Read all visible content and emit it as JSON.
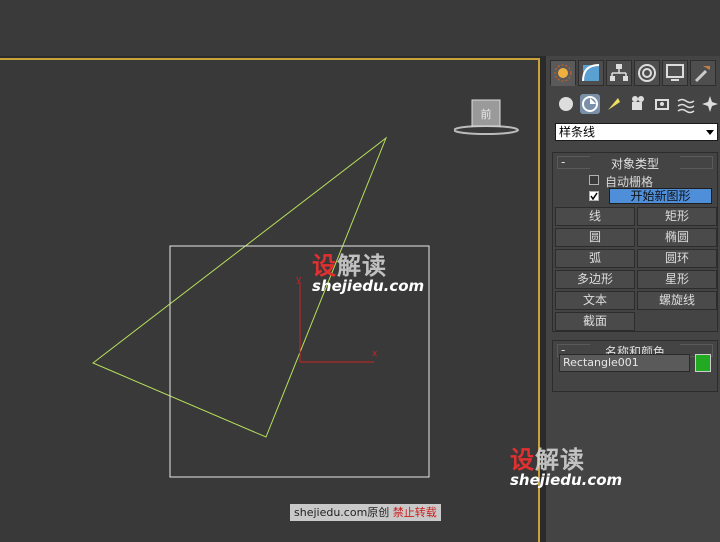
{
  "command_panel": {
    "tabs": [
      {
        "icon": "create-icon",
        "active": true
      },
      {
        "icon": "modify-icon",
        "active": false
      },
      {
        "icon": "hierarchy-icon",
        "active": false
      },
      {
        "icon": "motion-icon",
        "active": false
      },
      {
        "icon": "display-icon",
        "active": false
      },
      {
        "icon": "utilities-icon",
        "active": false
      }
    ],
    "subcategories": [
      {
        "icon": "geometry-icon",
        "active": false
      },
      {
        "icon": "shapes-icon",
        "active": true
      },
      {
        "icon": "lights-icon",
        "active": false
      },
      {
        "icon": "cameras-icon",
        "active": false
      },
      {
        "icon": "helpers-icon",
        "active": false
      },
      {
        "icon": "space-warps-icon",
        "active": false
      },
      {
        "icon": "systems-icon",
        "active": false
      }
    ],
    "category_dropdown": "样条线",
    "object_type": {
      "title": "对象类型",
      "auto_grid_label": "自动栅格",
      "auto_grid_checked": false,
      "start_new_shape_checked": true,
      "start_new_shape_label": "开始新图形",
      "buttons": [
        "线",
        "矩形",
        "圆",
        "椭圆",
        "弧",
        "圆环",
        "多边形",
        "星形",
        "文本",
        "螺旋线",
        "截面"
      ]
    },
    "name_and_color": {
      "title": "名称和颜色",
      "object_name": "Rectangle001",
      "color": "#22aa22"
    }
  },
  "viewport": {
    "gizmo_x_label": "x",
    "gizmo_y_label": "y",
    "viewcube_label": "前"
  },
  "watermarks": {
    "brand_red": "设",
    "brand_rest": "解读",
    "url": "shejiedu.com",
    "copyright_site": "shejiedu.com原创",
    "copyright_note": "禁止转载"
  },
  "colors": {
    "border_active": "#c9a23a",
    "spline_green": "#b8e05a",
    "selection_blue": "#4f8ed8"
  }
}
